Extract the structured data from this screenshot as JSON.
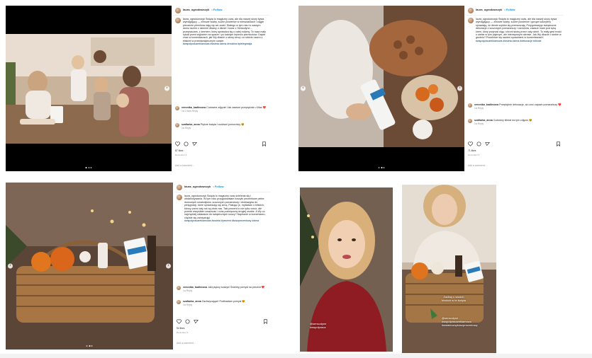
{
  "post1": {
    "username": "laura_ogrodowczyk",
    "follow": "• Follow",
    "caption": "laura_ogrodowczyk Święta to magiczny czas, ale dla naszej skóry bywa wymagający — zimowe wiatry, suche powietrze w mieszkaniach i ciągłe pieczenie pierników dają się we znaki. Dlatego w tym roku w naszym domu razem z dziećmi dbamy o dłonie i twarz z Sensodyne… przepraszam, z kremem, który sprawdza się u całej rodziny. To nasz mały rytuał przed wyjściem na spacer i po każdym lepieniu pierniczków. Dajcie znać w komentarzach, jak Wy dbacie o skórę zimą i co robicie razem z bliskimi w przedświątecznym czasie.",
    "tags": "#wspolpracareklamowa #swieta #zima #rodzina #pielegnacja",
    "comment1_user": "veronika_kadlecova",
    "comment1_text": "Cudowne zdjęcie! Jak zawsze przepięknie u Was ❤️",
    "comment1_meta": "1w  2 likes  Reply",
    "comment2_user": "szafiarka_anna",
    "comment2_text": "Piękne święta i cudowni pomocnicy 😍",
    "comment2_meta": "1w  Reply",
    "likes": "87 likes",
    "date": "December 8",
    "add_comment": "Add a comment…"
  },
  "post2": {
    "username": "laura_ogrodowczyk",
    "follow": "• Follow",
    "caption": "laura_ogrodowczyk Święta to magiczny czas, ale dla naszej skóry bywa wymagający — zimowe wiatry, suche powietrze i gorące kaloryfery sprawiają, że dłonie szybko się przesuszają. Przygotowując świąteczne dekoracje z suszonych pomarańczy i orzechów, zawsze mam pod ręką krem, który przynosi ulgę i chroni skórę przez cały dzień. To mały gest troski o siebie w tym pięknym, ale intensywnym okresie. Jak Wy dbacie o siebie w grudniu? Podzielcie się swoimi sposobami w komentarzach!",
    "tags": "#wspolpracareklamowa #swieta #zima #dekoracje #dlonie",
    "comment1_user": "veronika_kadlecova",
    "comment1_text": "Przepiękne dekoracje, aż czuć zapach pomarańczy ❤️",
    "comment1_meta": "1w  Reply",
    "comment2_user": "szafiarka_anna",
    "comment2_text": "Cudowny klimat na tym zdjęciu 😍",
    "comment2_meta": "1w  Reply",
    "likes": "71 likes",
    "date": "December 5",
    "add_comment": "Add a comment…"
  },
  "post3": {
    "username": "laura_ogrodowczyk",
    "follow": "• Follow",
    "caption": "laura_ogrodowczyk Święta to magiczny czas dzielenia się i obdarowywania. W tym roku przygotowałam koszyki prezentowe pełne domowych smakołyków, suszonych pomarańczy i drobiazgów do pielęgnacji, które sprawdzają się zimą. Pakując je, myślałam o bliskich, którzy przez cały rok są obok nas. Taki prezent to nie tylko rzecz, ale przede wszystkim uważność i czas poświęcony drugiej osobie. A Wy co najchętniej wkładacie do świątecznych koszy? Napiszcie w komentarzu, chętnie się zainspiruję!",
    "tags": "#wspolpracareklamowa #swieta #prezent #koszprezentowy #zima",
    "comment1_user": "veronika_kadlecova",
    "comment1_text": "Jaki piękny koszyk! Świetny pomysł na prezent ❤️",
    "comment1_meta": "1w  Reply",
    "comment2_user": "szafiarka_anna",
    "comment2_text": "Zachwycające! Podkradam pomysł 😍",
    "comment2_meta": "1w  Reply",
    "likes": "54 likes",
    "date": "December 3",
    "add_comment": "Add a comment…"
  },
  "story2": {
    "line1": "Zadbaj o swoich",
    "line2": "bliskich w te święta",
    "mention1": "@sensodyne",
    "mention2": "#wspolpracareklamowa",
    "mention3": "#swiatecznykoszprezentowy"
  },
  "story1": {
    "mention1": "@sensodyne",
    "mention2": "#wspolpraca"
  },
  "colors": {
    "link": "#00376b",
    "follow": "#0095f6",
    "meta": "#8e8e8e"
  }
}
